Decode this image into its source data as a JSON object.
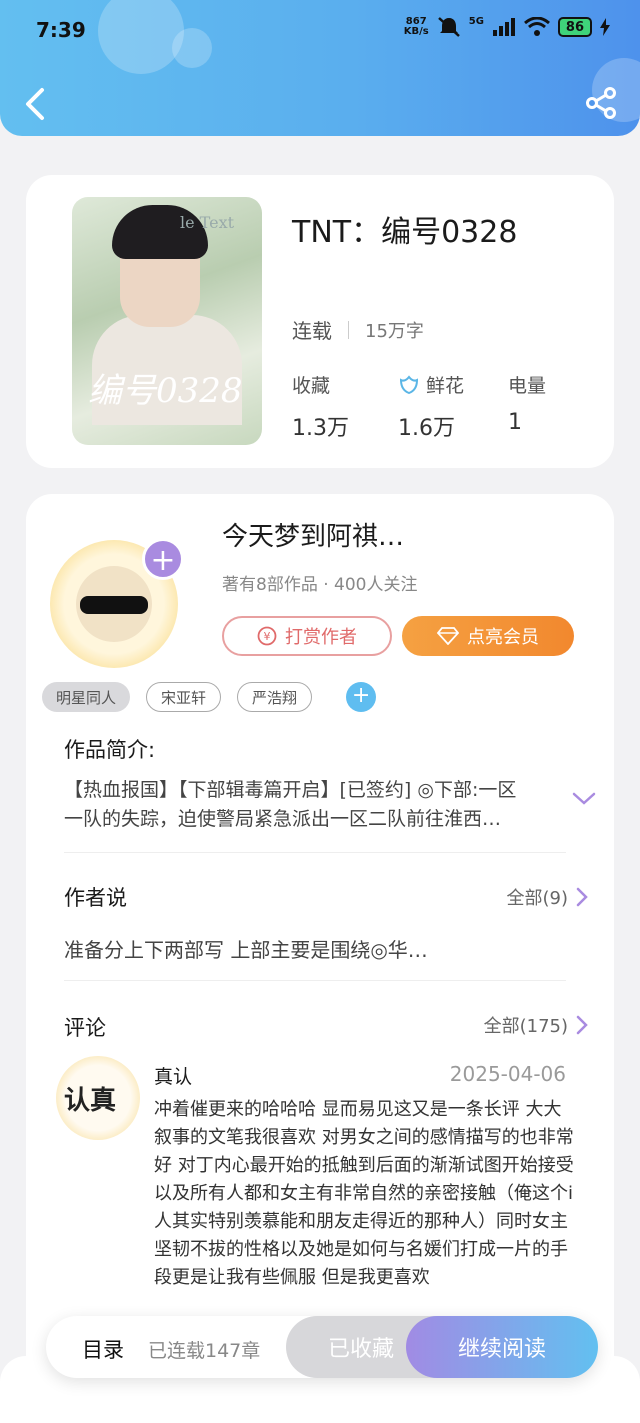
{
  "status_bar": {
    "time": "7:39",
    "net_speed_value": "867",
    "net_speed_unit": "KB/s",
    "network": "5G",
    "battery": "86"
  },
  "header": {
    "back_icon": "chevron-left-icon",
    "share_icon": "share-icon",
    "gradient_start": "#63bff0",
    "gradient_end": "#4e92ec"
  },
  "book": {
    "title": "TNT：编号0328",
    "cover_title": "编号0328",
    "cover_subtitle": "le Text",
    "status": "连载",
    "word_count": "15万字",
    "stats": [
      {
        "label": "收藏",
        "value": "1.3万"
      },
      {
        "label": "鲜花",
        "value": "1.6万"
      },
      {
        "label": "电量",
        "value": "1"
      }
    ]
  },
  "author": {
    "name": "今天梦到阿祺…",
    "summary": "著有8部作品 · 400人关注",
    "tip_button": "打赏作者",
    "vip_button": "点亮会员",
    "follow_icon": "plus-icon"
  },
  "tags": [
    "明星同人",
    "宋亚轩",
    "严浩翔"
  ],
  "intro": {
    "title": "作品简介:",
    "line1": "【热血报国】【下部辑毒篇开启】[已签约] ◎下部:一区",
    "line2": "一队的失踪，迫使警局紧急派出一区二队前往淮西…"
  },
  "author_says": {
    "title": "作者说",
    "more": "全部(9)",
    "text": "准备分上下两部写 上部主要是围绕◎华…"
  },
  "comments": {
    "title": "评论",
    "more": "全部(175)",
    "items": [
      {
        "avatar_text": "认真",
        "user": "真认",
        "date": "2025-04-06",
        "body": "冲着催更来的哈哈哈 显而易见这又是一条长评 大大叙事的文笔我很喜欢 对男女之间的感情描写的也非常好 对丁内心最开始的抵触到后面的渐渐试图开始接受 以及所有人都和女主有非常自然的亲密接触（俺这个i人其实特别羡慕能和朋友走得近的那种人）同时女主坚韧不拔的性格以及她是如何与名媛们打成一片的手段更是让我有些佩服 但是我更喜欢"
      }
    ]
  },
  "bottom_bar": {
    "toc": "目录",
    "chapter_count": "已连载147章",
    "favorited": "已收藏",
    "continue": "继续阅读"
  }
}
